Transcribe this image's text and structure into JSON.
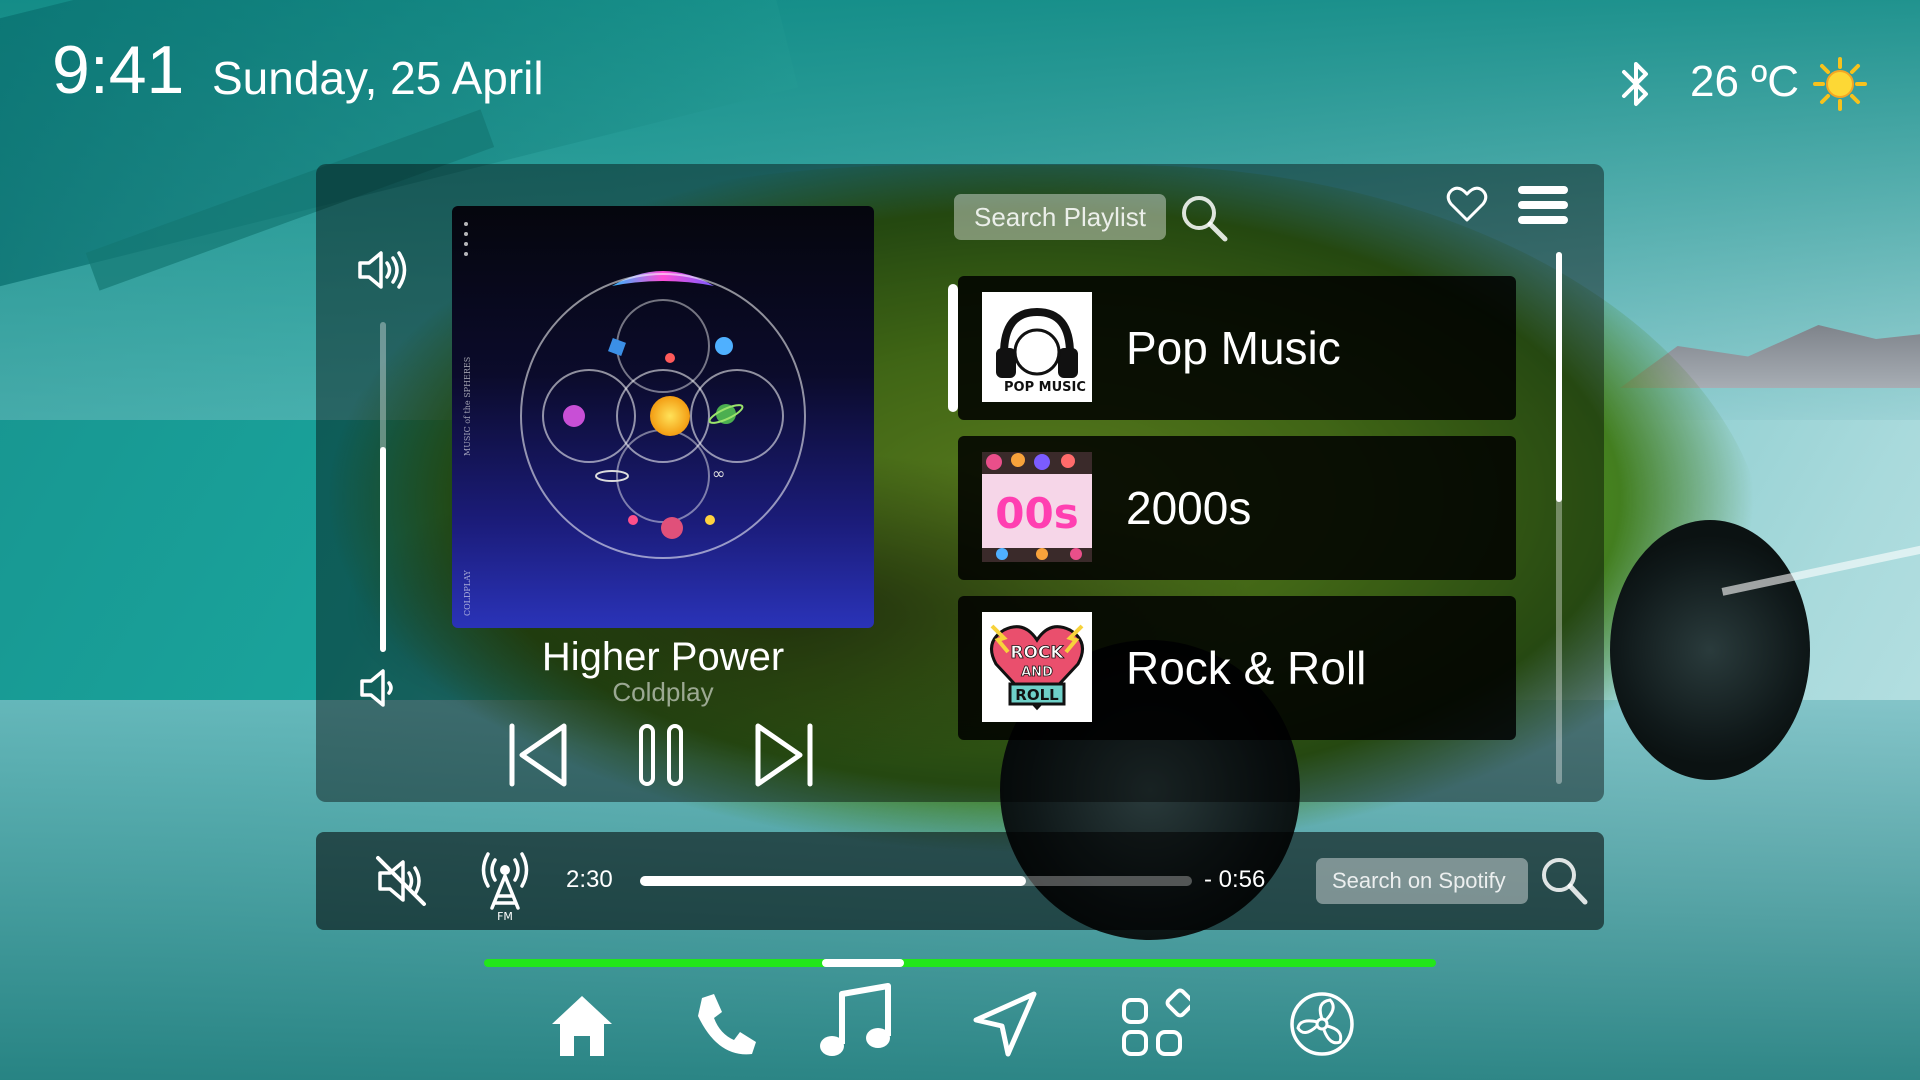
{
  "status": {
    "time": "9:41",
    "date": "Sunday, 25 April",
    "temperature": "26 ºC",
    "bluetooth_icon": "bluetooth-icon",
    "weather_icon": "sun-icon"
  },
  "player": {
    "volume_level": 0.62,
    "track_title": "Higher Power",
    "track_artist": "Coldplay",
    "album_cover_text": "MUSIC of the SPHERES",
    "album_cover_artist": "COLDPLAY",
    "controls": [
      "previous-icon",
      "pause-icon",
      "next-icon"
    ]
  },
  "playlists": {
    "search_placeholder": "Search Playlist",
    "items": [
      {
        "name": "Pop Music",
        "thumb_text": "POP MUSIC",
        "selected": true
      },
      {
        "name": "2000s",
        "thumb_text": "00s",
        "selected": false
      },
      {
        "name": "Rock & Roll",
        "thumb_text_top": "ROCK",
        "thumb_text_mid": "AND",
        "thumb_text_bottom": "ROLL",
        "selected": false
      }
    ],
    "scroll_position": 0
  },
  "bottom_bar": {
    "elapsed": "2:30",
    "remaining": "- 0:56",
    "progress": 0.7,
    "fm_label": "FM",
    "spotify_search_placeholder": "Search on Spotify"
  },
  "nav": {
    "items": [
      "home-icon",
      "phone-icon",
      "music-icon",
      "navigation-icon",
      "apps-icon",
      "fan-icon"
    ],
    "active": "music-icon"
  },
  "colors": {
    "accent_green": "#22e61a",
    "panel_bg": "rgba(0,0,0,0.42)"
  }
}
